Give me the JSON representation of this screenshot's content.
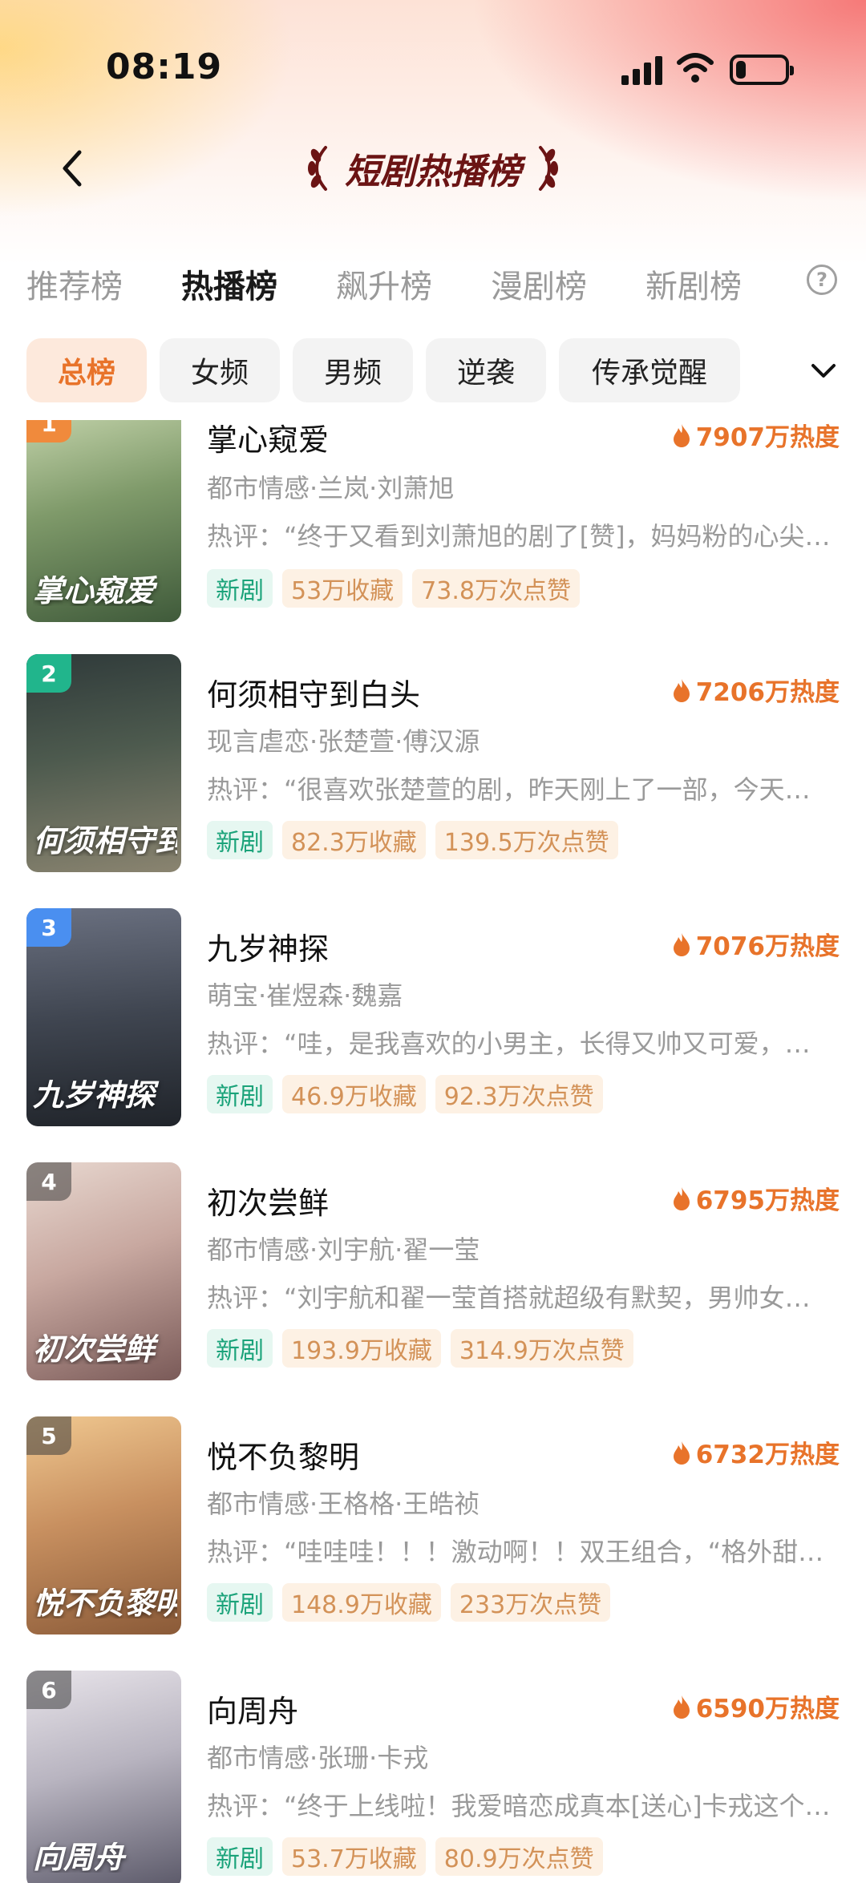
{
  "status_bar": {
    "time": "08:19",
    "battery_level": 0.2
  },
  "nav": {
    "title": "短剧热播榜"
  },
  "tabs": [
    "推荐榜",
    "热播榜",
    "飙升榜",
    "漫剧榜",
    "新剧榜"
  ],
  "active_tab": "热播榜",
  "help_label": "?",
  "chips": [
    "总榜",
    "女频",
    "男频",
    "逆袭",
    "传承觉醒"
  ],
  "active_chip": "总榜",
  "colors": {
    "accent": "#e8732a",
    "new_tag": "#1ba37a",
    "stat_tag": "#d39258",
    "rank1": "#f08a3c",
    "rank2": "#21b58c",
    "rank3": "#4a8ff0",
    "rank_other": "#6b6b6b"
  },
  "dramas": [
    {
      "rank": "1",
      "title": "掌心窥爱",
      "heat": "7907万热度",
      "meta": "都市情感·兰岚·刘萧旭",
      "comment": "热评：“终于又看到刘萧旭的剧了[赞]，妈妈粉的心尖…",
      "tags": [
        "新剧",
        "53万收藏",
        "73.8万次点赞"
      ],
      "poster_text": "掌心窥爱"
    },
    {
      "rank": "2",
      "title": "何须相守到白头",
      "heat": "7206万热度",
      "meta": "现言虐恋·张楚萱·傅汉源",
      "comment": "热评：“很喜欢张楚萱的剧，昨天刚上了一部，今天…",
      "tags": [
        "新剧",
        "82.3万收藏",
        "139.5万次点赞"
      ],
      "poster_text": "何须相守到白头"
    },
    {
      "rank": "3",
      "title": "九岁神探",
      "heat": "7076万热度",
      "meta": "萌宝·崔煜森·魏嘉",
      "comment": "热评：“哇，是我喜欢的小男主，长得又帅又可爱，…",
      "tags": [
        "新剧",
        "46.9万收藏",
        "92.3万次点赞"
      ],
      "poster_text": "九岁神探"
    },
    {
      "rank": "4",
      "title": "初次尝鲜",
      "heat": "6795万热度",
      "meta": "都市情感·刘宇航·翟一莹",
      "comment": "热评：“刘宇航和翟一莹首搭就超级有默契，男帅女…",
      "tags": [
        "新剧",
        "193.9万收藏",
        "314.9万次点赞"
      ],
      "poster_text": "初次尝鲜"
    },
    {
      "rank": "5",
      "title": "悦不负黎明",
      "heat": "6732万热度",
      "meta": "都市情感·王格格·王皓祯",
      "comment": "热评：“哇哇哇！！！激动啊！！双王组合，“格外甜…",
      "tags": [
        "新剧",
        "148.9万收藏",
        "233万次点赞"
      ],
      "poster_text": "悦不负黎明"
    },
    {
      "rank": "6",
      "title": "向周舟",
      "heat": "6590万热度",
      "meta": "都市情感·张珊·卡戎",
      "comment": "热评：“终于上线啦！我爱暗恋成真本[送心]卡戎这个…",
      "tags": [
        "新剧",
        "53.7万收藏",
        "80.9万次点赞"
      ],
      "poster_text": "向周舟"
    }
  ]
}
